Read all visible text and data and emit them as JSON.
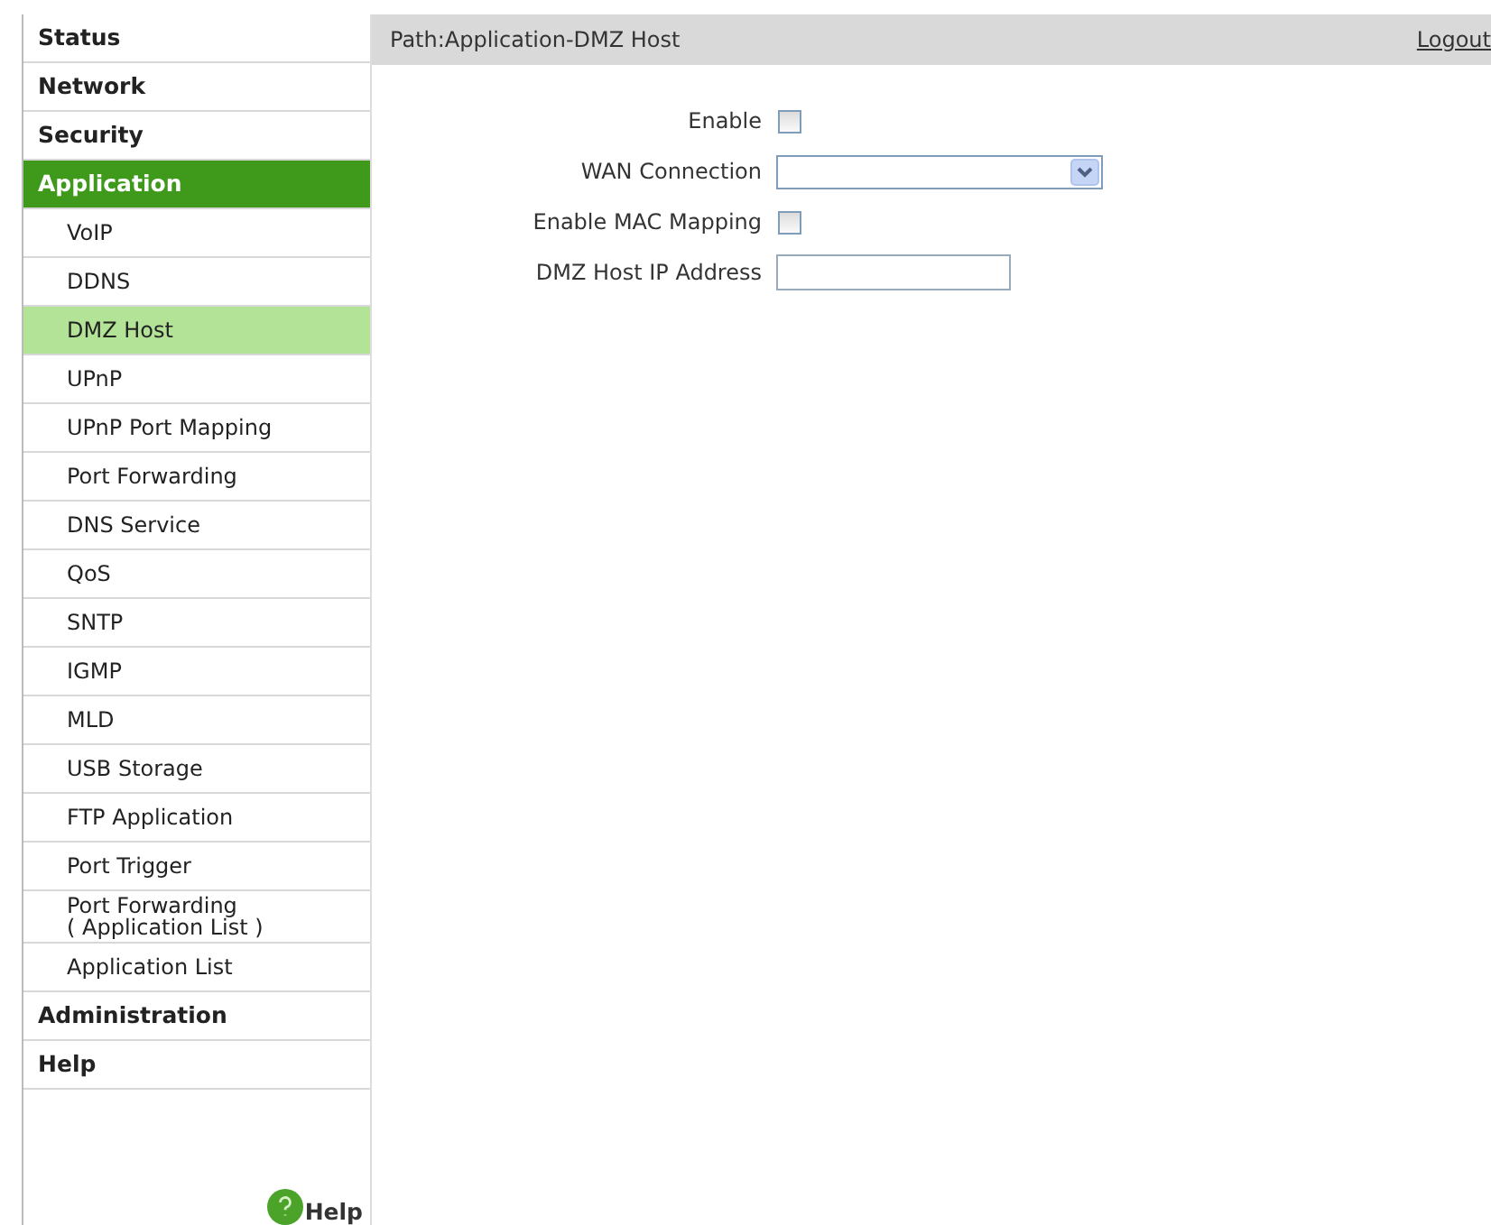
{
  "sidebar": {
    "sections": [
      {
        "label": "Status",
        "selected": false
      },
      {
        "label": "Network",
        "selected": false
      },
      {
        "label": "Security",
        "selected": false
      },
      {
        "label": "Application",
        "selected": true,
        "children": [
          {
            "label": "VoIP",
            "selected": false
          },
          {
            "label": "DDNS",
            "selected": false
          },
          {
            "label": "DMZ Host",
            "selected": true
          },
          {
            "label": "UPnP",
            "selected": false
          },
          {
            "label": "UPnP Port Mapping",
            "selected": false
          },
          {
            "label": "Port Forwarding",
            "selected": false
          },
          {
            "label": "DNS Service",
            "selected": false
          },
          {
            "label": "QoS",
            "selected": false
          },
          {
            "label": "SNTP",
            "selected": false
          },
          {
            "label": "IGMP",
            "selected": false
          },
          {
            "label": "MLD",
            "selected": false
          },
          {
            "label": "USB Storage",
            "selected": false
          },
          {
            "label": "FTP Application",
            "selected": false
          },
          {
            "label": "Port Trigger",
            "selected": false
          },
          {
            "label": "Port Forwarding\n( Application List )",
            "selected": false
          },
          {
            "label": "Application List",
            "selected": false
          }
        ]
      },
      {
        "label": "Administration",
        "selected": false
      },
      {
        "label": "Help",
        "selected": false
      }
    ],
    "help_link": "Help"
  },
  "header": {
    "path": "Path:Application-DMZ Host",
    "logout": "Logout"
  },
  "form": [
    {
      "kind": "checkbox",
      "label": "Enable",
      "checked": false
    },
    {
      "kind": "select",
      "label": "WAN Connection"
    },
    {
      "kind": "checkbox",
      "label": "Enable MAC Mapping",
      "checked": false
    },
    {
      "kind": "text",
      "label": "DMZ Host IP Address"
    }
  ]
}
